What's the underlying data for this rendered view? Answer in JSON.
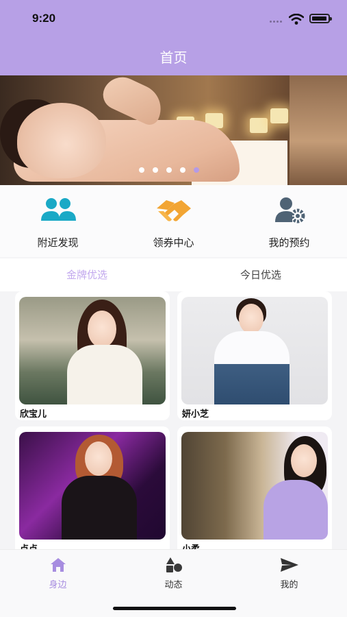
{
  "status_bar": {
    "time": "9:20"
  },
  "header": {
    "title": "首页",
    "accent_color": "#b7a0e6"
  },
  "banner": {
    "slides": 5,
    "active_slide": 5
  },
  "quick_menu": [
    {
      "label": "附近发现",
      "icon": "users-icon"
    },
    {
      "label": "领券中心",
      "icon": "handshake-icon"
    },
    {
      "label": "我的预约",
      "icon": "user-settings-icon"
    }
  ],
  "tabs": [
    {
      "label": "金牌优选",
      "active": true
    },
    {
      "label": "今日优选",
      "active": false
    }
  ],
  "cards": [
    {
      "name": "欣宝儿"
    },
    {
      "name": "妍小芝"
    },
    {
      "name": "点点"
    },
    {
      "name": "小柔"
    }
  ],
  "bottom_nav": [
    {
      "label": "身边",
      "icon": "home-icon",
      "active": true
    },
    {
      "label": "动态",
      "icon": "shapes-icon",
      "active": false
    },
    {
      "label": "我的",
      "icon": "send-icon",
      "active": false
    }
  ]
}
